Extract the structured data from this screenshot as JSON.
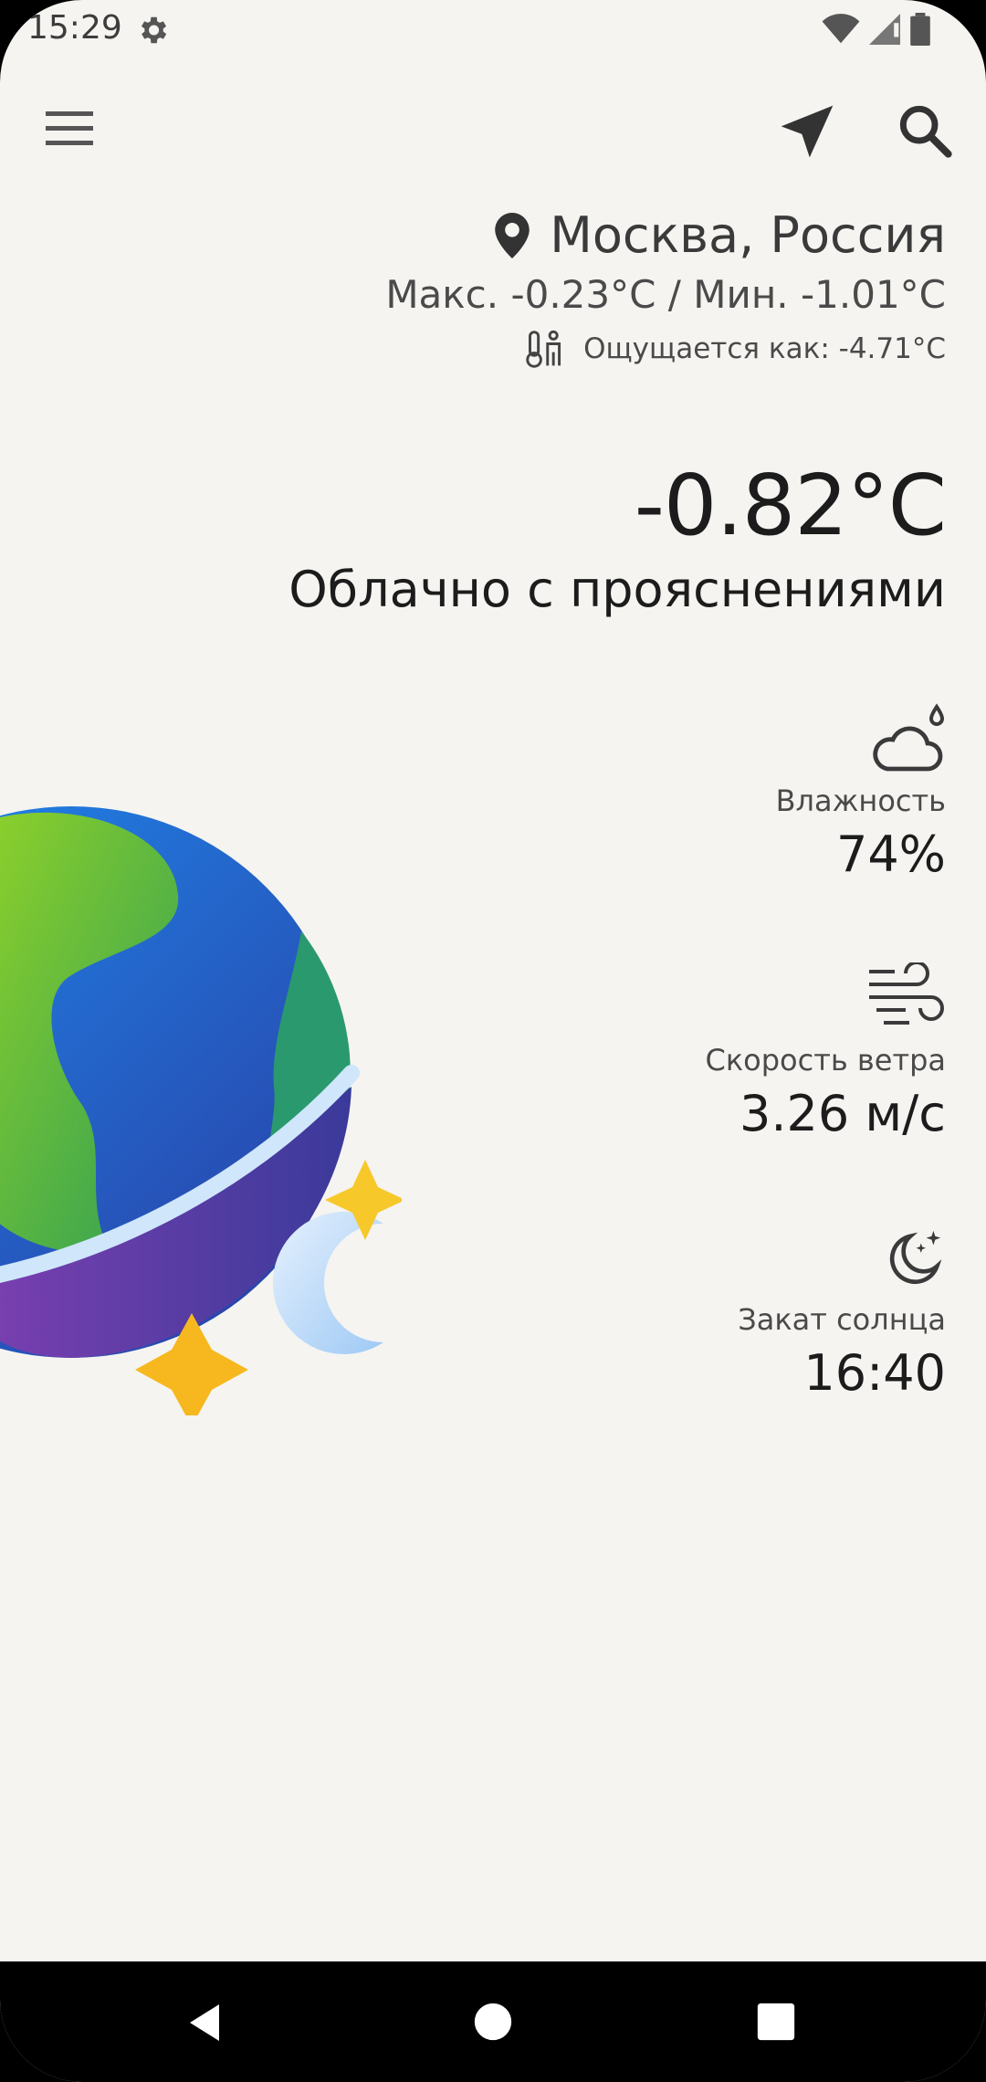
{
  "status_bar": {
    "time": "15:29"
  },
  "toolbar": {
    "menu_icon": "menu-icon",
    "location_icon": "navigation-arrow-icon",
    "search_icon": "search-icon"
  },
  "weather": {
    "location": "Москва, Россия",
    "max_min": "Макс. -0.23°C / Мин. -1.01°C",
    "feels_like": "Ощущается как: -4.71°C",
    "temperature": "-0.82°C",
    "description": "Облачно с прояснениями"
  },
  "stats": [
    {
      "icon": "cloud-humidity-icon",
      "label": "Влажность",
      "value": "74%"
    },
    {
      "icon": "wind-icon",
      "label": "Скорость ветра",
      "value": "3.26 м/с"
    },
    {
      "icon": "moon-stars-icon",
      "label": "Закат солнца",
      "value": "16:40"
    }
  ],
  "colors": {
    "background": "#f5f4f1",
    "text": "#1c1c1c",
    "nav_bar": "#000000"
  }
}
